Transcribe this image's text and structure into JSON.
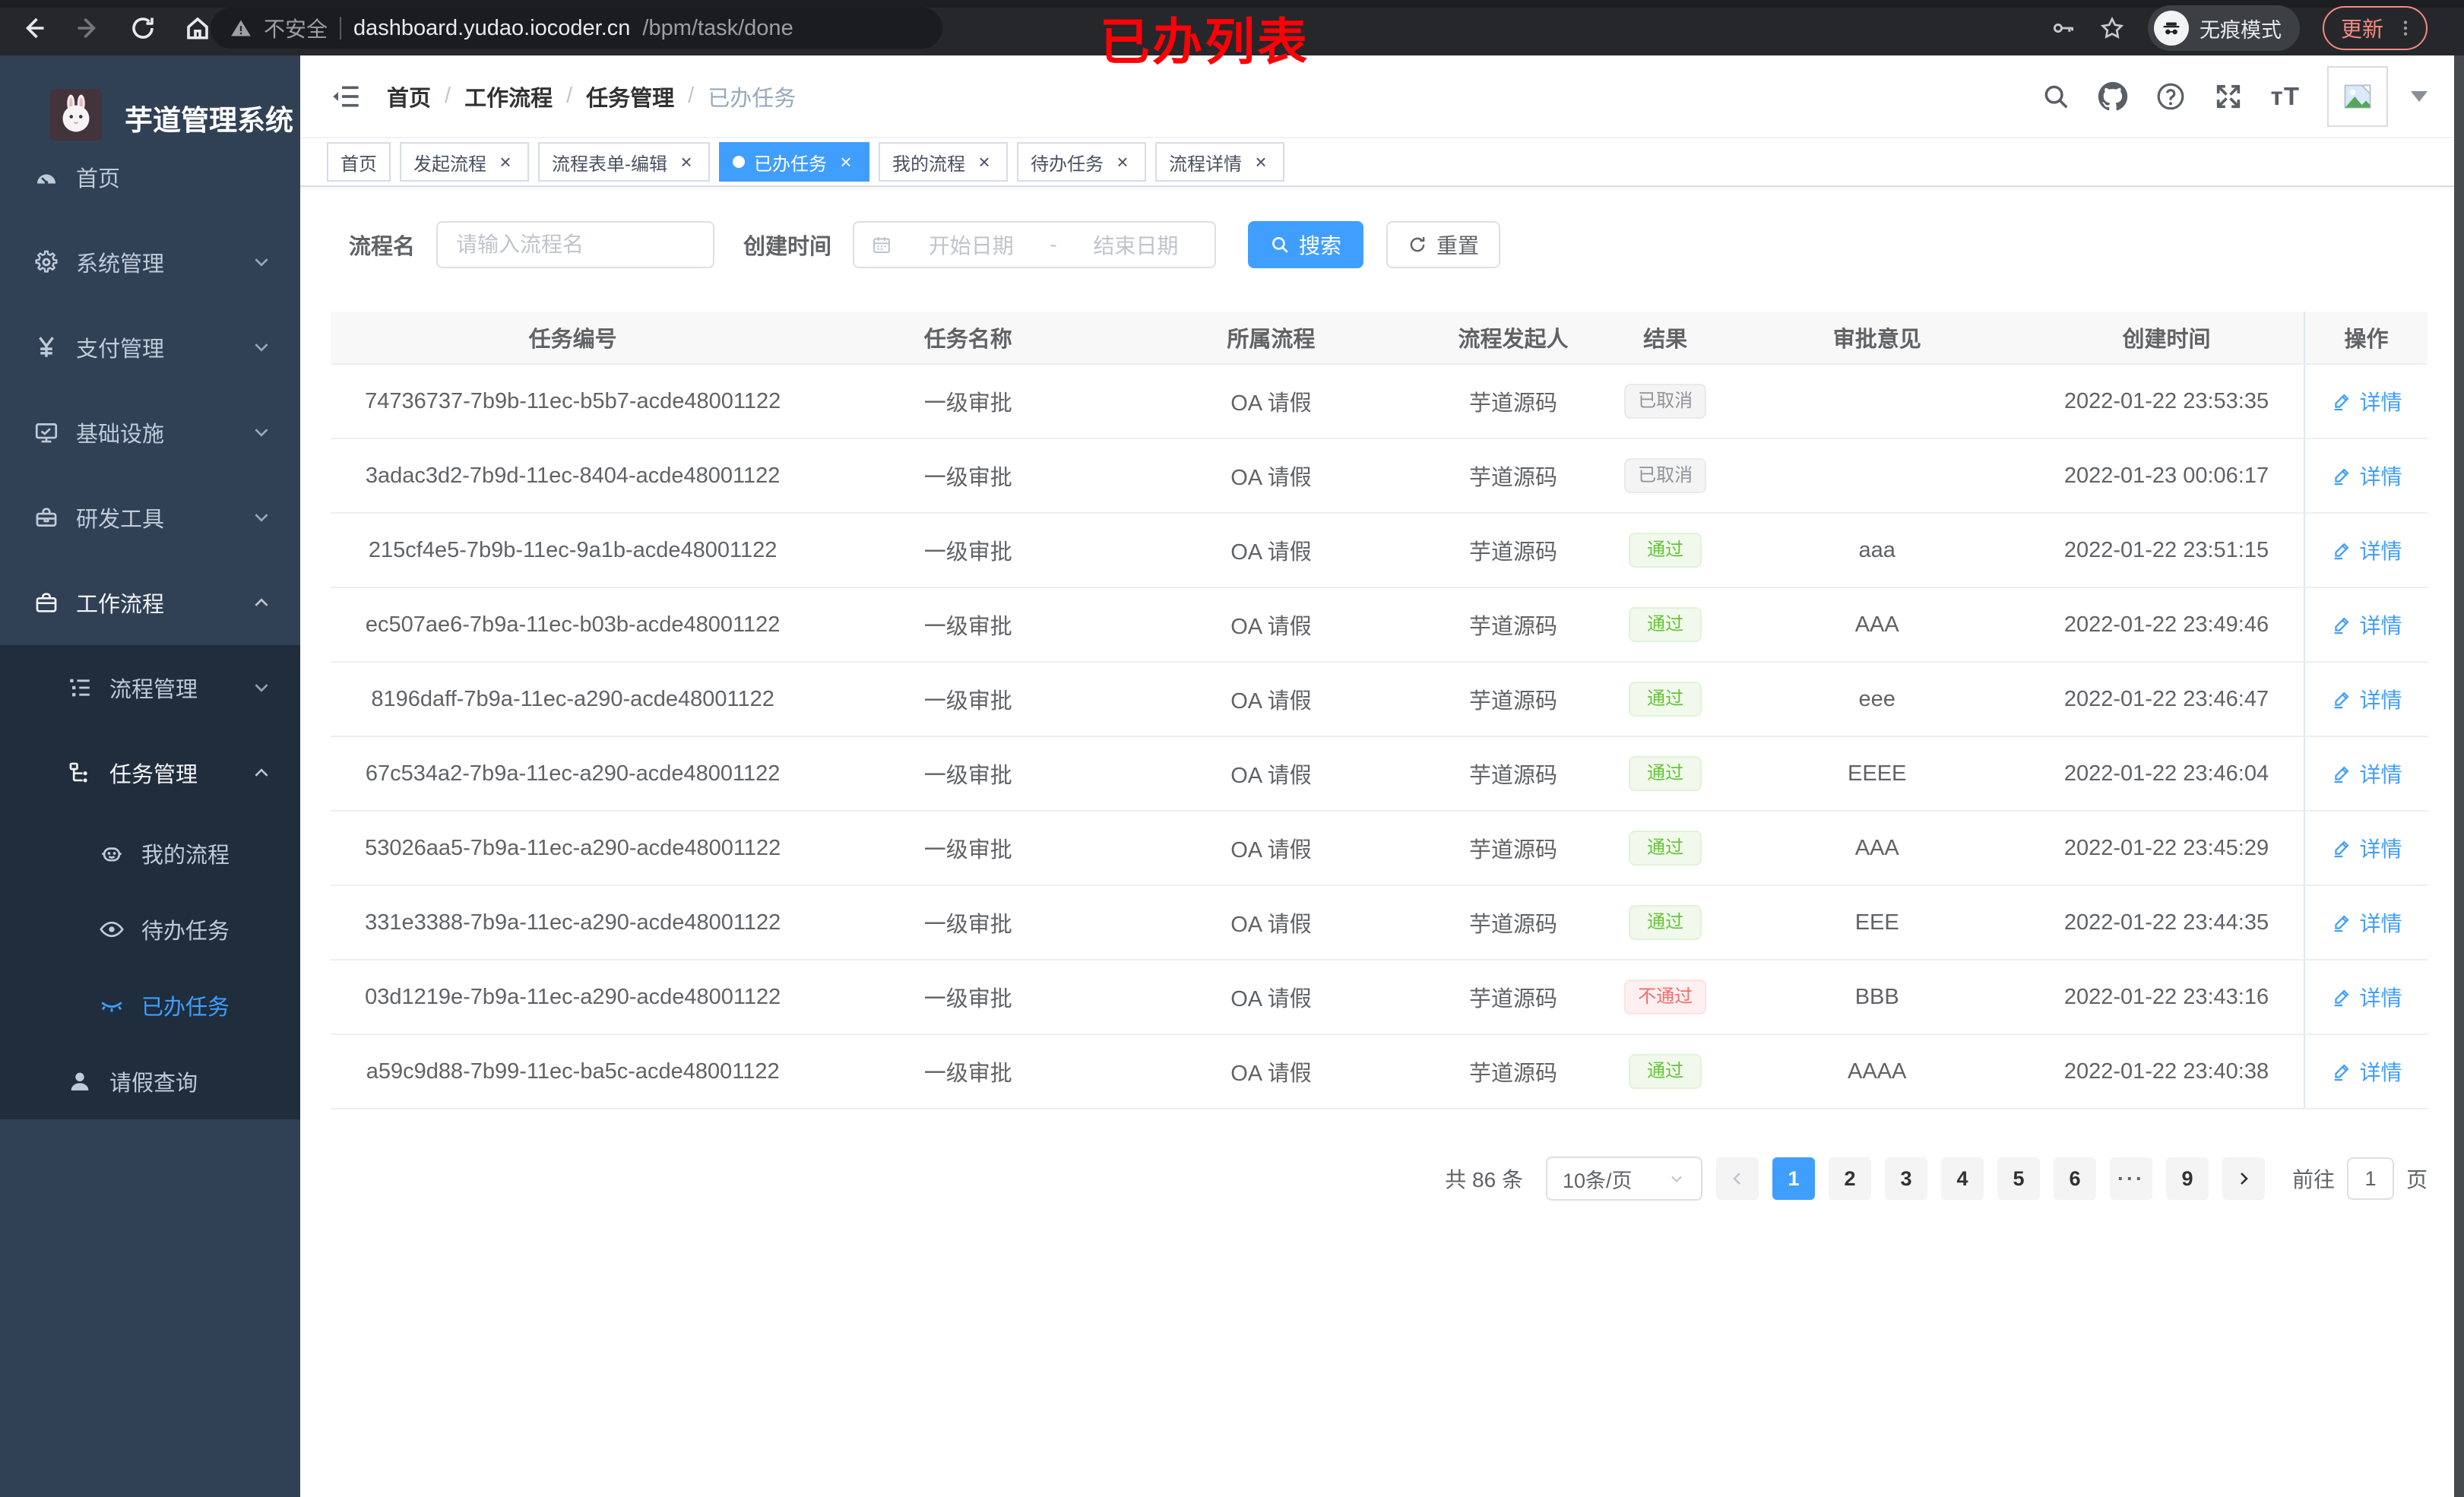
{
  "colors": {
    "accent": "#409eff",
    "success": "#67c23a",
    "danger": "#f56c6c",
    "info": "#909399",
    "sidebar_bg": "#304156",
    "submenu_bg": "#1f2d3d",
    "menu_text": "#bfcbd9",
    "annotation_red": "#fc0107"
  },
  "browser": {
    "security_label": "不安全",
    "url_host": "dashboard.yudao.iocoder.cn",
    "url_path": "/bpm/task/done",
    "incognito_label": "无痕模式",
    "update_label": "更新",
    "annotation": "已办列表"
  },
  "sidebar": {
    "title": "芋道管理系统",
    "items": [
      {
        "key": "home",
        "label": "首页",
        "icon": "dashboard-icon",
        "level": 1,
        "section": "root"
      },
      {
        "key": "system",
        "label": "系统管理",
        "icon": "gear-icon",
        "level": 1,
        "section": "root",
        "chevron": "down"
      },
      {
        "key": "payment",
        "label": "支付管理",
        "icon": "yen-icon",
        "level": 1,
        "section": "root",
        "chevron": "down"
      },
      {
        "key": "infra",
        "label": "基础设施",
        "icon": "monitor-icon",
        "level": 1,
        "section": "root",
        "chevron": "down"
      },
      {
        "key": "devtools",
        "label": "研发工具",
        "icon": "toolbox-icon",
        "level": 1,
        "section": "root",
        "chevron": "down"
      },
      {
        "key": "workflow",
        "label": "工作流程",
        "icon": "briefcase-icon",
        "level": 1,
        "section": "root",
        "chevron": "up",
        "open": true
      },
      {
        "key": "process-mgmt",
        "label": "流程管理",
        "icon": "list-tree-icon",
        "level": 2,
        "section": "sub",
        "chevron": "down"
      },
      {
        "key": "task-mgmt",
        "label": "任务管理",
        "icon": "hierarchy-icon",
        "level": 2,
        "section": "sub",
        "chevron": "up",
        "open": true
      },
      {
        "key": "my-process",
        "label": "我的流程",
        "icon": "robot-icon",
        "level": 3,
        "section": "sub",
        "compact": true
      },
      {
        "key": "todo-task",
        "label": "待办任务",
        "icon": "eye-icon",
        "level": 3,
        "section": "sub",
        "compact": true
      },
      {
        "key": "done-task",
        "label": "已办任务",
        "icon": "eye-closed-icon",
        "level": 3,
        "section": "sub",
        "compact": true,
        "active": true
      },
      {
        "key": "leave-query",
        "label": "请假查询",
        "icon": "user-icon",
        "level": 2,
        "section": "sub",
        "compact": true
      }
    ]
  },
  "breadcrumb": {
    "items": [
      "首页",
      "工作流程",
      "任务管理",
      "已办任务"
    ],
    "separator": "/"
  },
  "tabs": [
    {
      "key": "home",
      "label": "首页",
      "closable": false,
      "active": false
    },
    {
      "key": "start-process",
      "label": "发起流程",
      "closable": true,
      "active": false
    },
    {
      "key": "form-edit",
      "label": "流程表单-编辑",
      "closable": true,
      "active": false
    },
    {
      "key": "done-task",
      "label": "已办任务",
      "closable": true,
      "active": true
    },
    {
      "key": "my-process",
      "label": "我的流程",
      "closable": true,
      "active": false
    },
    {
      "key": "todo-task",
      "label": "待办任务",
      "closable": true,
      "active": false
    },
    {
      "key": "process-detail",
      "label": "流程详情",
      "closable": true,
      "active": false
    }
  ],
  "filters": {
    "name_label": "流程名",
    "name_placeholder": "请输入流程名",
    "time_label": "创建时间",
    "start_placeholder": "开始日期",
    "range_separator": "-",
    "end_placeholder": "结束日期",
    "search_label": "搜索",
    "reset_label": "重置"
  },
  "table": {
    "columns": [
      "任务编号",
      "任务名称",
      "所属流程",
      "流程发起人",
      "结果",
      "审批意见",
      "创建时间",
      "操作"
    ],
    "action_label": "详情",
    "rows": [
      {
        "id": "74736737-7b9b-11ec-b5b7-acde48001122",
        "name": "一级审批",
        "flow": "OA 请假",
        "starter": "芋道源码",
        "result": "已取消",
        "result_type": "info",
        "opinion": "",
        "created": "2022-01-22 23:53:35"
      },
      {
        "id": "3adac3d2-7b9d-11ec-8404-acde48001122",
        "name": "一级审批",
        "flow": "OA 请假",
        "starter": "芋道源码",
        "result": "已取消",
        "result_type": "info",
        "opinion": "",
        "created": "2022-01-23 00:06:17"
      },
      {
        "id": "215cf4e5-7b9b-11ec-9a1b-acde48001122",
        "name": "一级审批",
        "flow": "OA 请假",
        "starter": "芋道源码",
        "result": "通过",
        "result_type": "success",
        "opinion": "aaa",
        "created": "2022-01-22 23:51:15"
      },
      {
        "id": "ec507ae6-7b9a-11ec-b03b-acde48001122",
        "name": "一级审批",
        "flow": "OA 请假",
        "starter": "芋道源码",
        "result": "通过",
        "result_type": "success",
        "opinion": "AAA",
        "created": "2022-01-22 23:49:46"
      },
      {
        "id": "8196daff-7b9a-11ec-a290-acde48001122",
        "name": "一级审批",
        "flow": "OA 请假",
        "starter": "芋道源码",
        "result": "通过",
        "result_type": "success",
        "opinion": "eee",
        "created": "2022-01-22 23:46:47"
      },
      {
        "id": "67c534a2-7b9a-11ec-a290-acde48001122",
        "name": "一级审批",
        "flow": "OA 请假",
        "starter": "芋道源码",
        "result": "通过",
        "result_type": "success",
        "opinion": "EEEE",
        "created": "2022-01-22 23:46:04"
      },
      {
        "id": "53026aa5-7b9a-11ec-a290-acde48001122",
        "name": "一级审批",
        "flow": "OA 请假",
        "starter": "芋道源码",
        "result": "通过",
        "result_type": "success",
        "opinion": "AAA",
        "created": "2022-01-22 23:45:29"
      },
      {
        "id": "331e3388-7b9a-11ec-a290-acde48001122",
        "name": "一级审批",
        "flow": "OA 请假",
        "starter": "芋道源码",
        "result": "通过",
        "result_type": "success",
        "opinion": "EEE",
        "created": "2022-01-22 23:44:35"
      },
      {
        "id": "03d1219e-7b9a-11ec-a290-acde48001122",
        "name": "一级审批",
        "flow": "OA 请假",
        "starter": "芋道源码",
        "result": "不通过",
        "result_type": "danger",
        "opinion": "BBB",
        "created": "2022-01-22 23:43:16"
      },
      {
        "id": "a59c9d88-7b99-11ec-ba5c-acde48001122",
        "name": "一级审批",
        "flow": "OA 请假",
        "starter": "芋道源码",
        "result": "通过",
        "result_type": "success",
        "opinion": "AAAA",
        "created": "2022-01-22 23:40:38"
      }
    ]
  },
  "pagination": {
    "total_label": "共 86 条",
    "page_size_label": "10条/页",
    "pages": [
      "1",
      "2",
      "3",
      "4",
      "5",
      "6",
      "···",
      "9"
    ],
    "active_page": "1",
    "jump_label": "前往",
    "jump_value": "1",
    "jump_unit": "页"
  }
}
